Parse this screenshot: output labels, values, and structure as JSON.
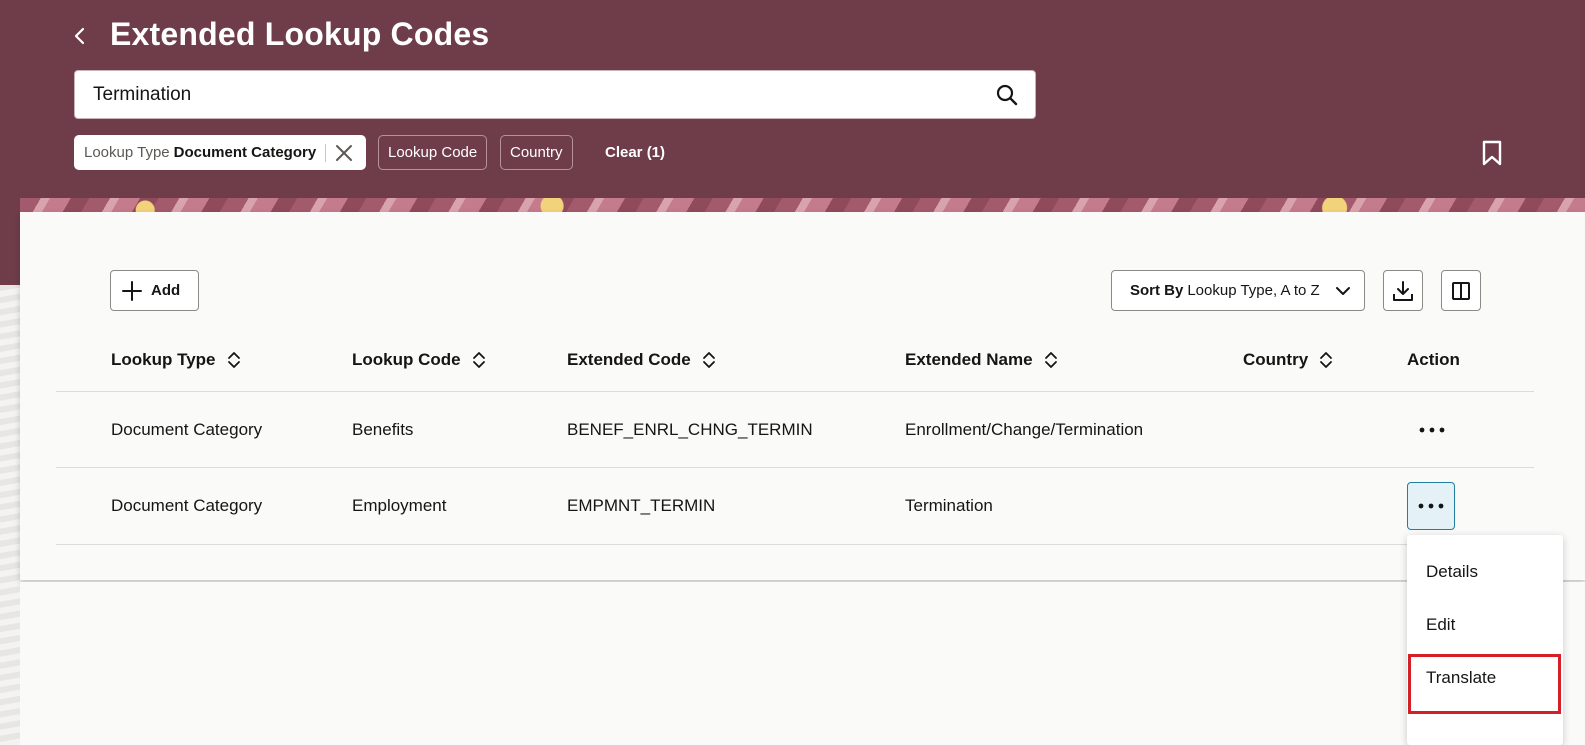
{
  "page": {
    "title": "Extended Lookup Codes",
    "back_label": "Back"
  },
  "search": {
    "value": "Termination",
    "placeholder": ""
  },
  "filters": {
    "active": {
      "label": "Lookup Type",
      "value": "Document Category"
    },
    "chips": [
      "Lookup Code",
      "Country"
    ],
    "clear_label": "Clear (1)"
  },
  "toolbar": {
    "add_label": "Add",
    "sort_prefix": "Sort By",
    "sort_value": "Lookup Type, A to Z"
  },
  "table": {
    "columns": [
      "Lookup Type",
      "Lookup Code",
      "Extended Code",
      "Extended Name",
      "Country",
      "Action"
    ],
    "rows": [
      {
        "lookup_type": "Document Category",
        "lookup_code": "Benefits",
        "extended_code": "BENEF_ENRL_CHNG_TERMIN",
        "extended_name": "Enrollment/Change/Termination",
        "country": ""
      },
      {
        "lookup_type": "Document Category",
        "lookup_code": "Employment",
        "extended_code": "EMPMNT_TERMIN",
        "extended_name": "Termination",
        "country": ""
      }
    ]
  },
  "action_menu": {
    "items": [
      "Details",
      "Edit",
      "Translate"
    ],
    "highlighted": "Translate"
  },
  "icons": {
    "back": "chevron-left-icon",
    "search": "search-icon",
    "close": "close-icon",
    "bookmark": "bookmark-icon",
    "add": "plus-icon",
    "sort": "chevron-down-icon",
    "download": "download-icon",
    "columns": "columns-icon",
    "more": "more-horizontal-icon"
  },
  "colors": {
    "header": "#6f3d4a",
    "highlight": "#d51f26",
    "active_button": "#e4f1f7"
  }
}
